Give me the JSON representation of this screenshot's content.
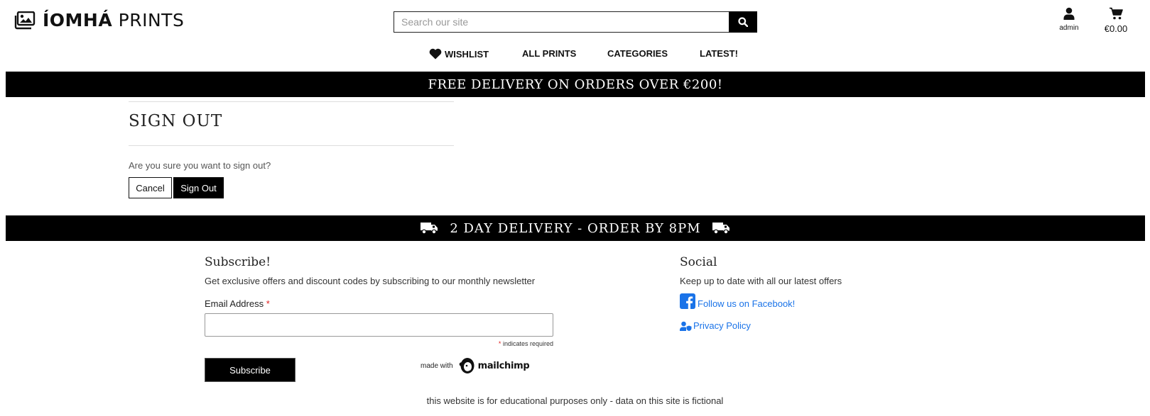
{
  "header": {
    "brand_bold": "ÍOMHÁ",
    "brand_thin": "PRINTS",
    "search_placeholder": "Search our site",
    "account_label": "admin",
    "cart_total": "€0.00"
  },
  "nav": {
    "items": [
      {
        "label": "WISHLIST",
        "icon": "heart-icon"
      },
      {
        "label": "ALL PRINTS"
      },
      {
        "label": "CATEGORIES"
      },
      {
        "label": "LATEST!"
      }
    ]
  },
  "top_banner": "FREE DELIVERY ON ORDERS OVER €200!",
  "signout": {
    "title": "SIGN OUT",
    "question": "Are you sure you want to sign out?",
    "cancel_label": "Cancel",
    "signout_label": "Sign Out"
  },
  "delivery_banner": "2 DAY DELIVERY - ORDER BY 8PM",
  "subscribe": {
    "title": "Subscribe!",
    "description": "Get exclusive offers and discount codes by subscribing to our monthly newsletter",
    "email_label": "Email Address",
    "required_mark": "*",
    "required_note": "indicates required",
    "button_label": "Subscribe",
    "made_with": "made with",
    "mailchimp": "mailchimp"
  },
  "social": {
    "title": "Social",
    "description": "Keep up to date with all our latest offers",
    "facebook_label": "Follow us on Facebook!",
    "privacy_label": "Privacy Policy"
  },
  "footer_note": "this website is for educational purposes only - data on this site is fictional",
  "colors": {
    "banner_bg": "#000000",
    "link": "#1a73e8",
    "required": "#e02020"
  }
}
